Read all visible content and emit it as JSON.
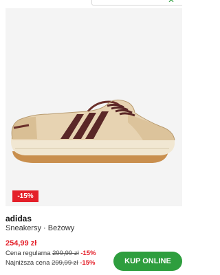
{
  "product": {
    "discount_badge": "-15%",
    "brand": "adidas",
    "description": "Sneakersy · Beżowy",
    "price_current": "254,99 zł",
    "regular_price": {
      "label": "Cena regularna",
      "old_price": "299,99 zł",
      "discount": "-15%"
    },
    "lowest_price": {
      "label": "Najniższa cena",
      "old_price": "299,99 zł",
      "discount": "-15%"
    },
    "image_icon": "sneaker-product-image"
  },
  "actions": {
    "buy_online_label": "KUP ONLINE"
  },
  "colors": {
    "accent_green": "#2e9e3e",
    "sale_red": "#e4202a"
  }
}
